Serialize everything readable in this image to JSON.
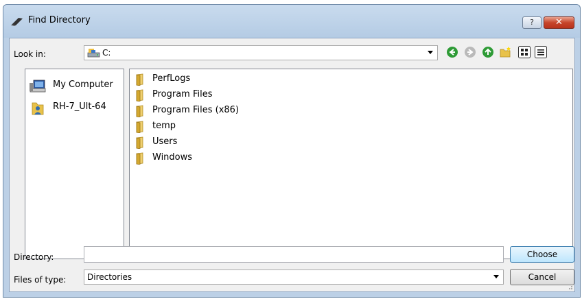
{
  "window": {
    "title": "Find Directory",
    "help_label": "?",
    "close_label": "✕"
  },
  "look_in": {
    "label": "Look in:",
    "value": "C:"
  },
  "toolbar": {
    "icons": [
      "back-icon",
      "forward-icon",
      "up-folder-icon",
      "new-folder-icon",
      "list-view-icon",
      "details-view-icon"
    ]
  },
  "places": [
    {
      "label": "My Computer",
      "icon": "computer-icon"
    },
    {
      "label": "RH-7_Ult-64",
      "icon": "user-folder-icon"
    }
  ],
  "files": [
    {
      "name": "PerfLogs"
    },
    {
      "name": "Program Files"
    },
    {
      "name": "Program Files (x86)"
    },
    {
      "name": "temp"
    },
    {
      "name": "Users"
    },
    {
      "name": "Windows"
    }
  ],
  "directory": {
    "label": "Directory:",
    "value": ""
  },
  "files_of_type": {
    "label": "Files of type:",
    "value": "Directories"
  },
  "buttons": {
    "choose": "Choose",
    "cancel": "Cancel"
  },
  "colors": {
    "titlebar": "#bcd0e6",
    "close_button": "#c7452b",
    "nav_green": "#2e9b36",
    "folder_yellow": "#e8c24a"
  }
}
